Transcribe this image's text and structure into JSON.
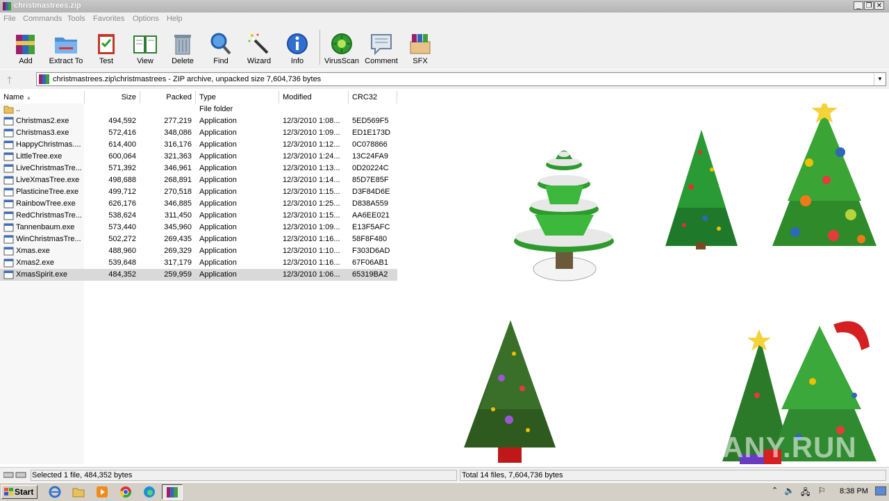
{
  "window": {
    "title": "christmastrees.zip"
  },
  "menu": [
    "File",
    "Commands",
    "Tools",
    "Favorites",
    "Options",
    "Help"
  ],
  "toolbar": [
    {
      "label": "Add",
      "icon": "winrar-books-icon"
    },
    {
      "label": "Extract To",
      "icon": "folder-extract-icon"
    },
    {
      "label": "Test",
      "icon": "clipboard-check-icon"
    },
    {
      "label": "View",
      "icon": "open-book-icon"
    },
    {
      "label": "Delete",
      "icon": "trash-can-icon"
    },
    {
      "label": "Find",
      "icon": "magnifier-icon"
    },
    {
      "label": "Wizard",
      "icon": "magic-wand-icon"
    },
    {
      "label": "Info",
      "icon": "info-icon"
    },
    {
      "label": "VirusScan",
      "icon": "virus-icon"
    },
    {
      "label": "Comment",
      "icon": "comment-icon"
    },
    {
      "label": "SFX",
      "icon": "sfx-box-icon"
    }
  ],
  "address": {
    "text": "christmastrees.zip\\christmastrees - ZIP archive, unpacked size 7,604,736 bytes"
  },
  "columns": {
    "name": "Name",
    "size": "Size",
    "packed": "Packed",
    "type": "Type",
    "modified": "Modified",
    "crc": "CRC32"
  },
  "files": [
    {
      "name": "..",
      "size": "",
      "packed": "",
      "type": "File folder",
      "modified": "",
      "crc": "",
      "folder": true
    },
    {
      "name": "Christmas2.exe",
      "size": "494,592",
      "packed": "277,219",
      "type": "Application",
      "modified": "12/3/2010 1:08...",
      "crc": "5ED569F5"
    },
    {
      "name": "Christmas3.exe",
      "size": "572,416",
      "packed": "348,086",
      "type": "Application",
      "modified": "12/3/2010 1:09...",
      "crc": "ED1E173D"
    },
    {
      "name": "HappyChristmas....",
      "size": "614,400",
      "packed": "316,176",
      "type": "Application",
      "modified": "12/3/2010 1:12...",
      "crc": "0C078866"
    },
    {
      "name": "LittleTree.exe",
      "size": "600,064",
      "packed": "321,363",
      "type": "Application",
      "modified": "12/3/2010 1:24...",
      "crc": "13C24FA9"
    },
    {
      "name": "LiveChristmasTre...",
      "size": "571,392",
      "packed": "346,961",
      "type": "Application",
      "modified": "12/3/2010 1:13...",
      "crc": "0D20224C"
    },
    {
      "name": "LiveXmasTree.exe",
      "size": "498,688",
      "packed": "268,891",
      "type": "Application",
      "modified": "12/3/2010 1:14...",
      "crc": "85D7E85F"
    },
    {
      "name": "PlasticineTree.exe",
      "size": "499,712",
      "packed": "270,518",
      "type": "Application",
      "modified": "12/3/2010 1:15...",
      "crc": "D3F84D6E"
    },
    {
      "name": "RainbowTree.exe",
      "size": "626,176",
      "packed": "346,885",
      "type": "Application",
      "modified": "12/3/2010 1:25...",
      "crc": "D838A559"
    },
    {
      "name": "RedChristmasTre...",
      "size": "538,624",
      "packed": "311,450",
      "type": "Application",
      "modified": "12/3/2010 1:15...",
      "crc": "AA6EE021"
    },
    {
      "name": "Tannenbaum.exe",
      "size": "573,440",
      "packed": "345,960",
      "type": "Application",
      "modified": "12/3/2010 1:09...",
      "crc": "E13F5AFC"
    },
    {
      "name": "WinChristmasTre...",
      "size": "502,272",
      "packed": "269,435",
      "type": "Application",
      "modified": "12/3/2010 1:16...",
      "crc": "58F8F480"
    },
    {
      "name": "Xmas.exe",
      "size": "488,960",
      "packed": "269,329",
      "type": "Application",
      "modified": "12/3/2010 1:10...",
      "crc": "F303D6AD"
    },
    {
      "name": "Xmas2.exe",
      "size": "539,648",
      "packed": "317,179",
      "type": "Application",
      "modified": "12/3/2010 1:16...",
      "crc": "67F06AB1"
    },
    {
      "name": "XmasSpirit.exe",
      "size": "484,352",
      "packed": "259,959",
      "type": "Application",
      "modified": "12/3/2010 1:06...",
      "crc": "65319BA2",
      "selected": true
    }
  ],
  "status": {
    "left": "Selected 1 file, 484,352 bytes",
    "right": "Total 14 files, 7,604,736 bytes"
  },
  "taskbar": {
    "start": "Start",
    "clock": "8:38 PM"
  },
  "watermark": "ANY.RUN"
}
